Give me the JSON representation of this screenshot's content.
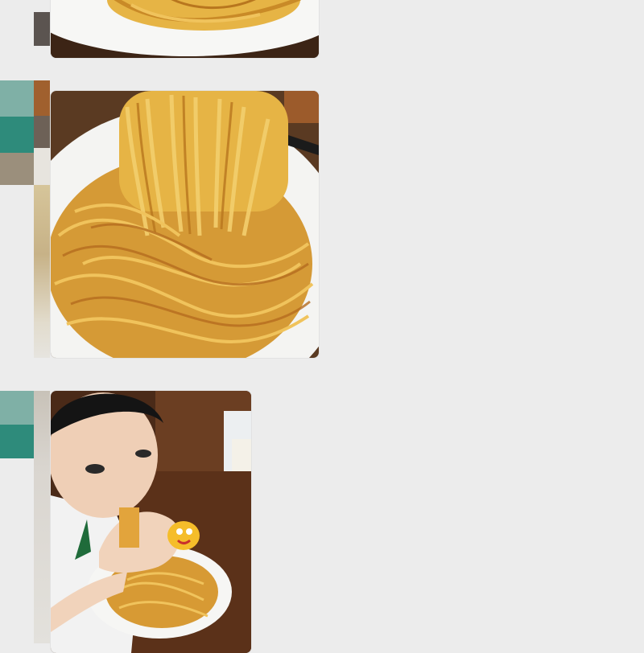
{
  "images": [
    {
      "name": "photo-pasta-plate-top",
      "alt": ""
    },
    {
      "name": "photo-pasta-twirled-fork",
      "alt": ""
    },
    {
      "name": "photo-child-eating-pasta",
      "alt": ""
    }
  ],
  "colors": {
    "background": "#ececec",
    "teal": "#2e8b7b",
    "teal_light": "#7fb0a6",
    "wood": "#5a3a22",
    "noodle": "#d8a23a",
    "plate": "#f7f7f5"
  }
}
